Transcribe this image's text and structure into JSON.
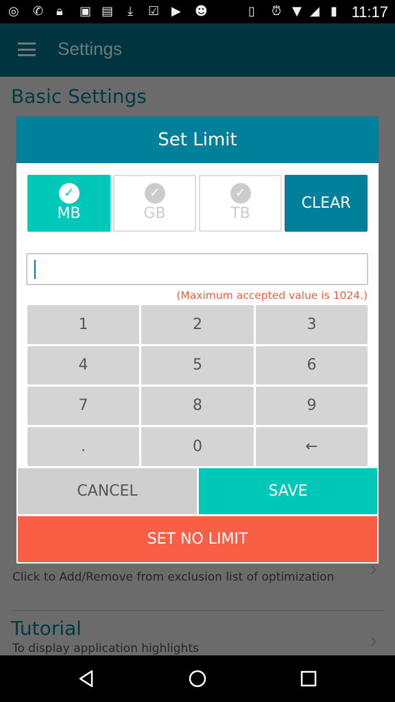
{
  "status_bar": {
    "time": "11:17"
  },
  "app_bar": {
    "title": "Settings"
  },
  "background": {
    "section_title": "Basic Settings",
    "exclusion_subtitle": "Click to Add/Remove from exclusion list of optimization",
    "tutorial_title": "Tutorial",
    "tutorial_subtitle": "To display application highlights"
  },
  "dialog": {
    "title": "Set Limit",
    "units": [
      {
        "label": "MB",
        "selected": true
      },
      {
        "label": "GB",
        "selected": false
      },
      {
        "label": "TB",
        "selected": false
      }
    ],
    "clear_label": "CLEAR",
    "input_value": "",
    "error_text": "(Maximum accepted value is 1024.)",
    "keys": [
      "1",
      "2",
      "3",
      "4",
      "5",
      "6",
      "7",
      "8",
      "9",
      ".",
      "0",
      "←"
    ],
    "cancel_label": "CANCEL",
    "save_label": "SAVE",
    "no_limit_label": "SET NO LIMIT"
  },
  "colors": {
    "primary": "#00809a",
    "accent": "#00c8b8",
    "danger": "#fa5f46",
    "error_text": "#f05a3c"
  }
}
